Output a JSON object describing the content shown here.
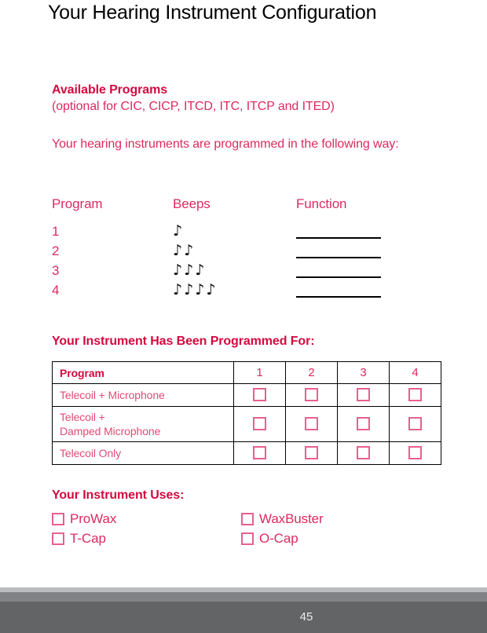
{
  "page": {
    "title": "Your Hearing Instrument Configuration",
    "number": "45"
  },
  "available_programs": {
    "heading": "Available Programs",
    "subheading": "(optional for CIC, CICP, ITCD, ITC, ITCP and ITED)",
    "intro": "Your hearing instruments are programmed in the following way:",
    "columns": {
      "program": "Program",
      "beeps": "Beeps",
      "function": "Function"
    },
    "rows": [
      {
        "program": "1",
        "beeps": "♪",
        "beep_count": 1,
        "function": ""
      },
      {
        "program": "2",
        "beeps": "♪♪",
        "beep_count": 2,
        "function": ""
      },
      {
        "program": "3",
        "beeps": "♪♪♪",
        "beep_count": 3,
        "function": ""
      },
      {
        "program": "4",
        "beeps": "♪♪♪♪",
        "beep_count": 4,
        "function": ""
      }
    ]
  },
  "programmed_for": {
    "heading": "Your Instrument Has Been Programmed For:",
    "header_label": "Program",
    "header_numbers": [
      "1",
      "2",
      "3",
      "4"
    ],
    "rows": [
      {
        "label": "Telecoil + Microphone",
        "label_line2": "",
        "checked": [
          false,
          false,
          false,
          false
        ]
      },
      {
        "label": "Telecoil +",
        "label_line2": "Damped Microphone",
        "checked": [
          false,
          false,
          false,
          false
        ]
      },
      {
        "label": "Telecoil Only",
        "label_line2": "",
        "checked": [
          false,
          false,
          false,
          false
        ]
      }
    ]
  },
  "instrument_uses": {
    "heading": "Your Instrument Uses:",
    "options": [
      {
        "label": "ProWax",
        "checked": false
      },
      {
        "label": "WaxBuster",
        "checked": false
      },
      {
        "label": "T-Cap",
        "checked": false
      },
      {
        "label": "O-Cap",
        "checked": false
      }
    ]
  },
  "colors": {
    "heading_crimson": "#D3093F",
    "body_crimson": "#DD2A5F",
    "table_text_pink": "#E24A77",
    "checkbox_pink": "#E8608C",
    "footer_dark": "#626466",
    "footer_mid": "#808285",
    "footer_light": "#B9BBBD"
  }
}
